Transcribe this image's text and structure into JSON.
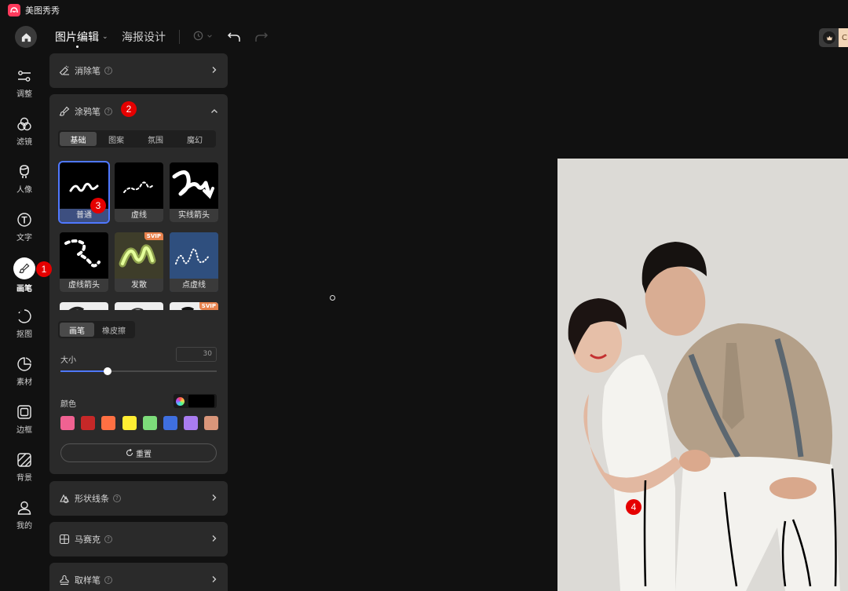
{
  "app": {
    "title": "美图秀秀"
  },
  "nav": {
    "tabs": [
      {
        "label": "图片编辑",
        "caret": "⌄"
      },
      {
        "label": "海报设计"
      }
    ]
  },
  "vip": {
    "text": "C"
  },
  "rail": [
    {
      "label": "调整",
      "icon": "sliders-icon"
    },
    {
      "label": "滤镜",
      "icon": "filter-icon"
    },
    {
      "label": "人像",
      "icon": "portrait-icon"
    },
    {
      "label": "文字",
      "icon": "text-icon"
    },
    {
      "label": "画笔",
      "icon": "brush-icon",
      "active": true
    },
    {
      "label": "抠图",
      "icon": "cutout-icon"
    },
    {
      "label": "素材",
      "icon": "sticker-icon"
    },
    {
      "label": "边框",
      "icon": "frame-icon"
    },
    {
      "label": "背景",
      "icon": "background-icon"
    },
    {
      "label": "我的",
      "icon": "user-icon"
    }
  ],
  "panel": {
    "eraser": {
      "title": "消除笔"
    },
    "doodle": {
      "title": "涂鸦笔",
      "tabs": [
        "基础",
        "图案",
        "氛围",
        "魔幻"
      ],
      "active_tab": "基础",
      "brushes": [
        {
          "name": "普通",
          "selected": true
        },
        {
          "name": "虚线"
        },
        {
          "name": "实线箭头"
        },
        {
          "name": "虚线箭头"
        },
        {
          "name": "发散",
          "badge": "SVIP"
        },
        {
          "name": "点虚线"
        },
        {
          "name": ""
        },
        {
          "name": ""
        },
        {
          "name": "",
          "badge": "SVIP"
        }
      ],
      "modes": [
        "画笔",
        "橡皮擦"
      ],
      "active_mode": "画笔",
      "size": {
        "label": "大小",
        "value": "30",
        "fraction": 0.3
      },
      "color": {
        "label": "颜色",
        "current": "#000000"
      },
      "swatches": [
        "#f06292",
        "#c62828",
        "#ff7043",
        "#ffee33",
        "#7ddc7a",
        "#3f6fe0",
        "#a97cf0",
        "#d9967a"
      ],
      "reset_label": "重置"
    },
    "shape_lines": {
      "title": "形状线条"
    },
    "mosaic": {
      "title": "马赛克"
    },
    "sampler": {
      "title": "取样笔"
    }
  },
  "markers": [
    "1",
    "2",
    "3",
    "4"
  ],
  "colors": {
    "accent": "#4f78ff",
    "marker": "#e50000",
    "panel": "#2a2a2a",
    "bg": "#111111"
  }
}
